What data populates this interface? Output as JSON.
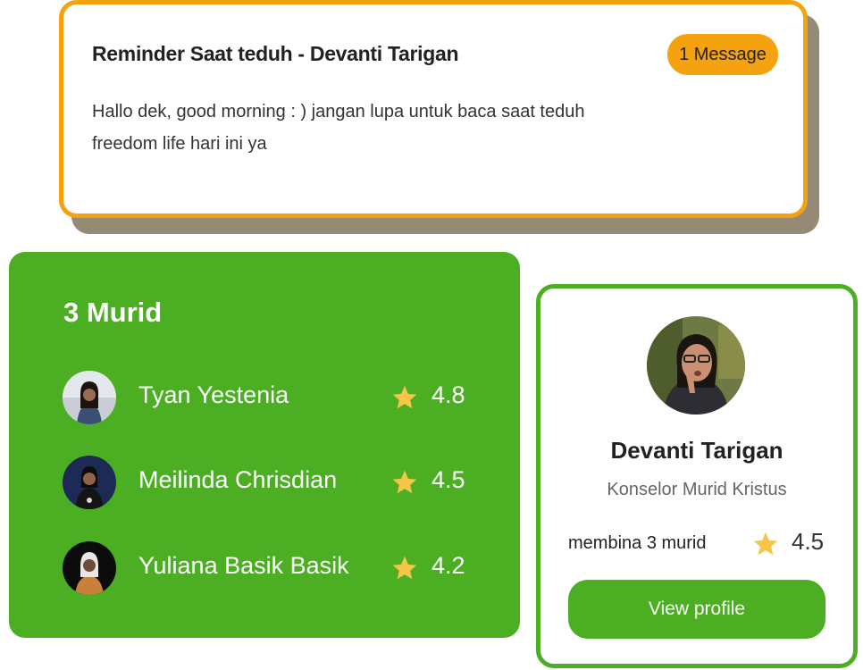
{
  "reminder": {
    "title": "Reminder Saat teduh - Devanti Tarigan",
    "badge": "1 Message",
    "message": "Hallo dek, good morning : ) jangan lupa untuk baca saat teduh freedom life hari ini ya"
  },
  "students": {
    "title": "3 Murid",
    "items": [
      {
        "name": "Tyan Yestenia",
        "rating": "4.8"
      },
      {
        "name": "Meilinda Chrisdian",
        "rating": "4.5"
      },
      {
        "name": "Yuliana Basik Basik",
        "rating": "4.2"
      }
    ]
  },
  "profile": {
    "name": "Devanti Tarigan",
    "role": "Konselor Murid Kristus",
    "stat": "membina 3 murid",
    "rating": "4.5",
    "button": "View profile"
  },
  "colors": {
    "accent_orange": "#f5a20f",
    "green": "#4caf23",
    "star": "#f7c646",
    "shadow": "#958a75"
  },
  "icons": {
    "star": "star-icon",
    "avatar": "avatar"
  }
}
